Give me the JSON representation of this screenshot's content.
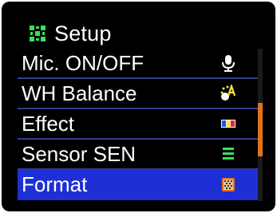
{
  "header": {
    "title": "Setup",
    "icon": "setup-grid-icon"
  },
  "menu": {
    "items": [
      {
        "label": "Mic. ON/OFF",
        "icon": "microphone-icon",
        "selected": false
      },
      {
        "label": "WH Balance",
        "icon": "white-balance-icon",
        "selected": false
      },
      {
        "label": "Effect",
        "icon": "color-effect-icon",
        "selected": false
      },
      {
        "label": "Sensor SEN",
        "icon": "sensor-sensitivity-icon",
        "selected": false
      },
      {
        "label": "Format",
        "icon": "format-card-icon",
        "selected": true
      }
    ]
  },
  "scrollbar": {
    "position_fraction": 0.55,
    "thumb_fraction": 0.35
  },
  "colors": {
    "background": "#000000",
    "selected_row": "#1f2fd6",
    "row_divider": "#333e8c",
    "scroll_thumb": "#e0741b",
    "accent_green": "#3adf5a",
    "text": "#ffffff"
  }
}
